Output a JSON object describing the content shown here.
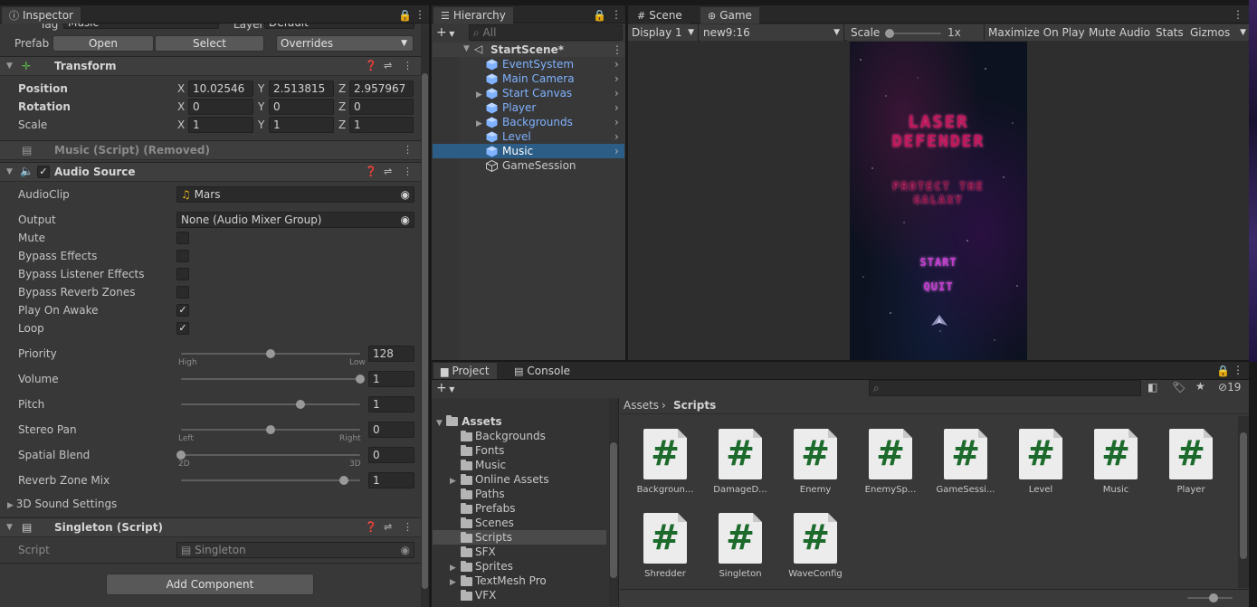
{
  "inspector": {
    "tab_title": "Inspector",
    "tag_label": "Tag",
    "tag_value": "Music",
    "layer_label": "Layer",
    "layer_value": "Default",
    "prefab_label": "Prefab",
    "open_label": "Open",
    "select_label": "Select",
    "overrides_label": "Overrides",
    "transform": {
      "title": "Transform",
      "position_label": "Position",
      "rotation_label": "Rotation",
      "scale_label": "Scale",
      "x": "X",
      "y": "Y",
      "z": "Z",
      "position": [
        "10.02546",
        "2.513815",
        "2.957967"
      ],
      "rotation": [
        "0",
        "0",
        "0"
      ],
      "scale": [
        "1",
        "1",
        "1"
      ]
    },
    "removed_script": "Music (Script) (Removed)",
    "audio_source": {
      "title": "Audio Source",
      "audioclip_label": "AudioClip",
      "audioclip_value": "Mars",
      "output_label": "Output",
      "output_value": "None (Audio Mixer Group)",
      "toggles": [
        {
          "label": "Mute",
          "checked": false
        },
        {
          "label": "Bypass Effects",
          "checked": false
        },
        {
          "label": "Bypass Listener Effects",
          "checked": false
        },
        {
          "label": "Bypass Reverb Zones",
          "checked": false
        },
        {
          "label": "Play On Awake",
          "checked": true
        },
        {
          "label": "Loop",
          "checked": true
        }
      ],
      "sliders": [
        {
          "label": "Priority",
          "value": "128",
          "fraction": 0.5,
          "min_label": "High",
          "max_label": "Low"
        },
        {
          "label": "Volume",
          "value": "1",
          "fraction": 1.0
        },
        {
          "label": "Pitch",
          "value": "1",
          "fraction": 0.667
        },
        {
          "label": "Stereo Pan",
          "value": "0",
          "fraction": 0.5,
          "min_label": "Left",
          "max_label": "Right"
        },
        {
          "label": "Spatial Blend",
          "value": "0",
          "fraction": 0.0,
          "min_label": "2D",
          "max_label": "3D"
        },
        {
          "label": "Reverb Zone Mix",
          "value": "1",
          "fraction": 0.909
        }
      ],
      "sound_settings_label": "3D Sound Settings"
    },
    "singleton": {
      "title": "Singleton (Script)",
      "script_label": "Script",
      "script_value": "Singleton"
    },
    "add_component_label": "Add Component"
  },
  "hierarchy": {
    "tab_title": "Hierarchy",
    "search_placeholder": "All",
    "scene_name": "StartScene*",
    "items": [
      {
        "name": "EventSystem",
        "expandable": false,
        "selected": false,
        "prefab": true
      },
      {
        "name": "Main Camera",
        "expandable": false,
        "selected": false,
        "prefab": true
      },
      {
        "name": "Start Canvas",
        "expandable": true,
        "selected": false,
        "prefab": true
      },
      {
        "name": "Player",
        "expandable": false,
        "selected": false,
        "prefab": true
      },
      {
        "name": "Backgrounds",
        "expandable": true,
        "selected": false,
        "prefab": true
      },
      {
        "name": "Level",
        "expandable": false,
        "selected": false,
        "prefab": true
      },
      {
        "name": "Music",
        "expandable": false,
        "selected": true,
        "prefab": true
      },
      {
        "name": "GameSession",
        "expandable": false,
        "selected": false,
        "prefab": false
      }
    ]
  },
  "game_view": {
    "scene_tab": "Scene",
    "game_tab": "Game",
    "display": "Display 1",
    "aspect": "new9:16",
    "scale_label": "Scale",
    "scale_value": "1x",
    "maximize_label": "Maximize On Play",
    "mute_label": "Mute Audio",
    "stats_label": "Stats",
    "gizmos_label": "Gizmos",
    "title_line1": "LASER",
    "title_line2": "DEFENDER",
    "subtitle_line1": "PROTECT THE",
    "subtitle_line2": "GALAXY",
    "start_label": "START",
    "quit_label": "QUIT"
  },
  "project": {
    "project_tab": "Project",
    "console_tab": "Console",
    "hidden_count": "19",
    "breadcrumb_root": "Assets",
    "breadcrumb_current": "Scripts",
    "tree_root": "Assets",
    "folders": [
      {
        "name": "Backgrounds",
        "expandable": false,
        "selected": false
      },
      {
        "name": "Fonts",
        "expandable": false,
        "selected": false
      },
      {
        "name": "Music",
        "expandable": false,
        "selected": false
      },
      {
        "name": "Online Assets",
        "expandable": true,
        "selected": false
      },
      {
        "name": "Paths",
        "expandable": false,
        "selected": false
      },
      {
        "name": "Prefabs",
        "expandable": false,
        "selected": false
      },
      {
        "name": "Scenes",
        "expandable": false,
        "selected": false
      },
      {
        "name": "Scripts",
        "expandable": false,
        "selected": true
      },
      {
        "name": "SFX",
        "expandable": false,
        "selected": false
      },
      {
        "name": "Sprites",
        "expandable": true,
        "selected": false
      },
      {
        "name": "TextMesh Pro",
        "expandable": true,
        "selected": false
      },
      {
        "name": "VFX",
        "expandable": false,
        "selected": false
      }
    ],
    "assets": [
      "Backgroun...",
      "DamageD...",
      "Enemy",
      "EnemySp...",
      "GameSessi...",
      "Level",
      "Music",
      "Player",
      "Shredder",
      "Singleton",
      "WaveConfig"
    ]
  },
  "colors": {
    "selection": "#2c5d87",
    "panel": "#383838",
    "prefab_blue": "#7fb2ff",
    "script_green": "#1c6b2c"
  }
}
